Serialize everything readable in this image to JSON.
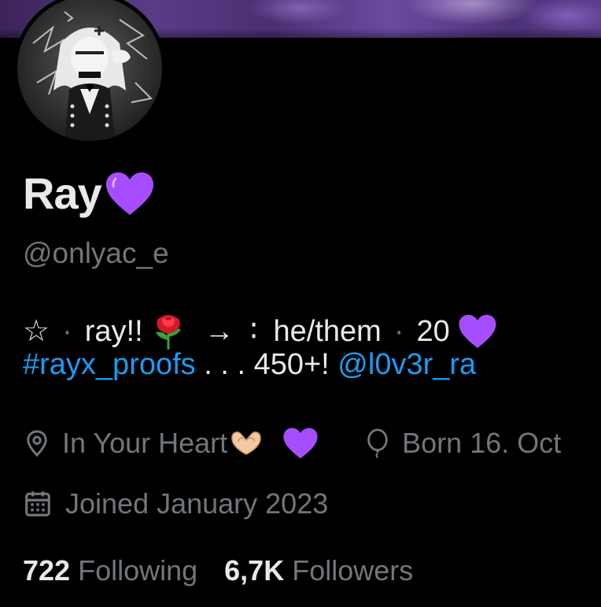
{
  "profile": {
    "display_name": "Ray",
    "name_emoji": "purple-heart",
    "handle": "@onlyac_e"
  },
  "bio": {
    "line1": {
      "star": "☆",
      "dot1": "·",
      "name": "ray!!",
      "rose": "🌹",
      "arrow": "→",
      "colon": "∶",
      "pronouns": "he/them",
      "dot2": "·",
      "age": "20",
      "heart": "purple-heart"
    },
    "line2": {
      "hashtag": "#rayx_proofs",
      "middle": " . . . 450+! ",
      "mention": "@l0v3r_ra"
    }
  },
  "meta": {
    "location": "In Your Heart",
    "location_emoji": "🫶💜",
    "birthday": "Born 16. Oct",
    "joined": "Joined January 2023"
  },
  "stats": {
    "following_count": "722",
    "following_label": "Following",
    "followers_count": "6,7K",
    "followers_label": "Followers"
  },
  "icons": {
    "location": "location-pin-icon",
    "birthday": "balloon-icon",
    "joined": "calendar-icon"
  },
  "colors": {
    "background": "#000000",
    "text_primary": "#e7e9ea",
    "text_secondary": "#71767b",
    "link": "#1d9bf0",
    "heart": "#a64dff",
    "banner": "#5a3b86"
  }
}
